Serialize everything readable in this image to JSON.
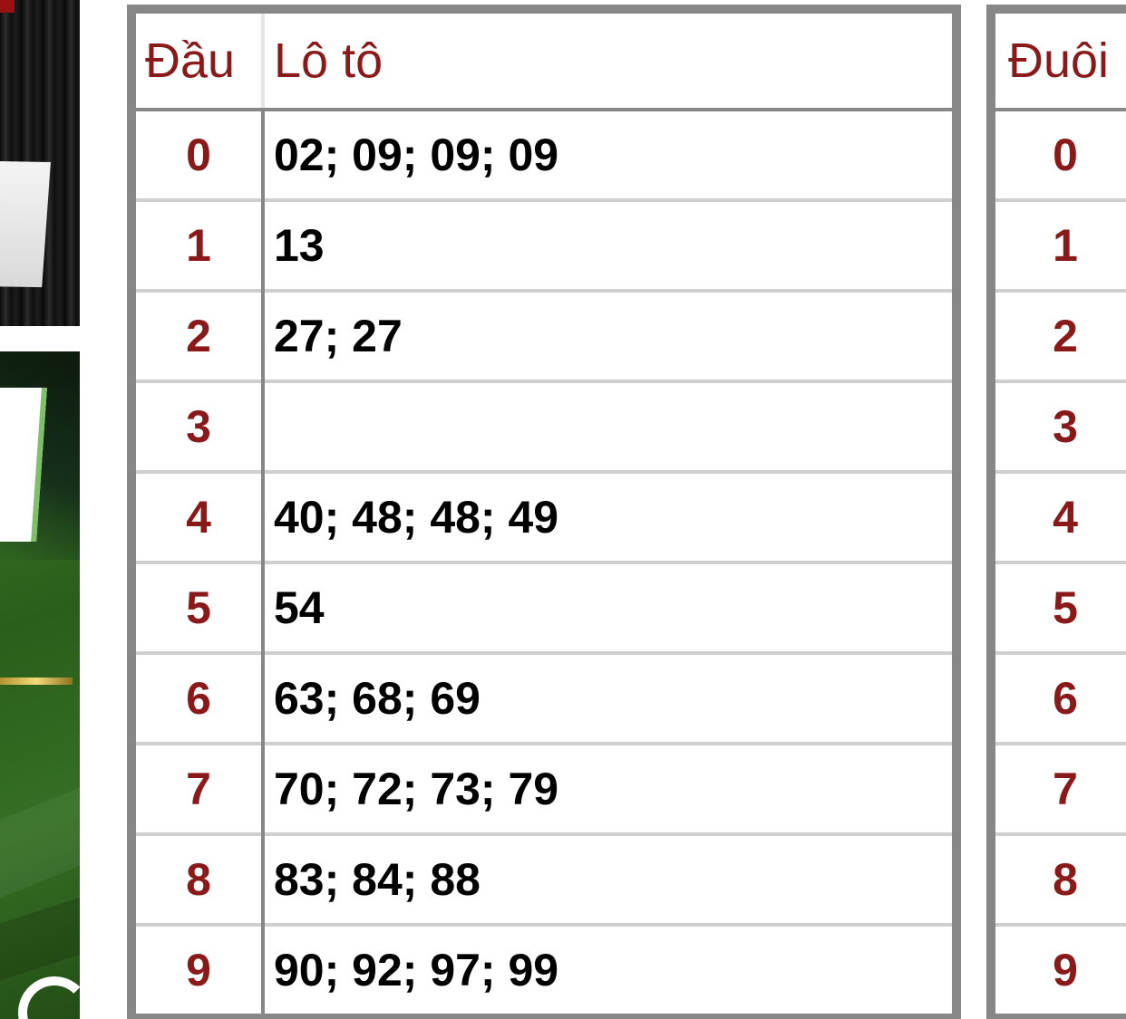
{
  "dau_table": {
    "header": {
      "head": "Đầu",
      "loto": "Lô tô"
    },
    "rows": [
      {
        "digit": "0",
        "numbers": "02; 09; 09; 09"
      },
      {
        "digit": "1",
        "numbers": "13"
      },
      {
        "digit": "2",
        "numbers": "27; 27"
      },
      {
        "digit": "3",
        "numbers": ""
      },
      {
        "digit": "4",
        "numbers": "40; 48; 48; 49"
      },
      {
        "digit": "5",
        "numbers": "54"
      },
      {
        "digit": "6",
        "numbers": "63; 68; 69"
      },
      {
        "digit": "7",
        "numbers": "70; 72; 73; 79"
      },
      {
        "digit": "8",
        "numbers": "83; 84; 88"
      },
      {
        "digit": "9",
        "numbers": "90; 92; 97; 99"
      }
    ]
  },
  "duoi_table": {
    "header": {
      "tail": "Đuôi"
    },
    "rows": [
      {
        "digit": "0"
      },
      {
        "digit": "1"
      },
      {
        "digit": "2"
      },
      {
        "digit": "3"
      },
      {
        "digit": "4"
      },
      {
        "digit": "5"
      },
      {
        "digit": "6"
      },
      {
        "digit": "7"
      },
      {
        "digit": "8"
      },
      {
        "digit": "9"
      }
    ]
  },
  "colors": {
    "accent_red": "#8a1a1a",
    "border_gray": "#878787",
    "row_divider": "#cfcfcf",
    "banner_green": "#2a5e1b"
  }
}
